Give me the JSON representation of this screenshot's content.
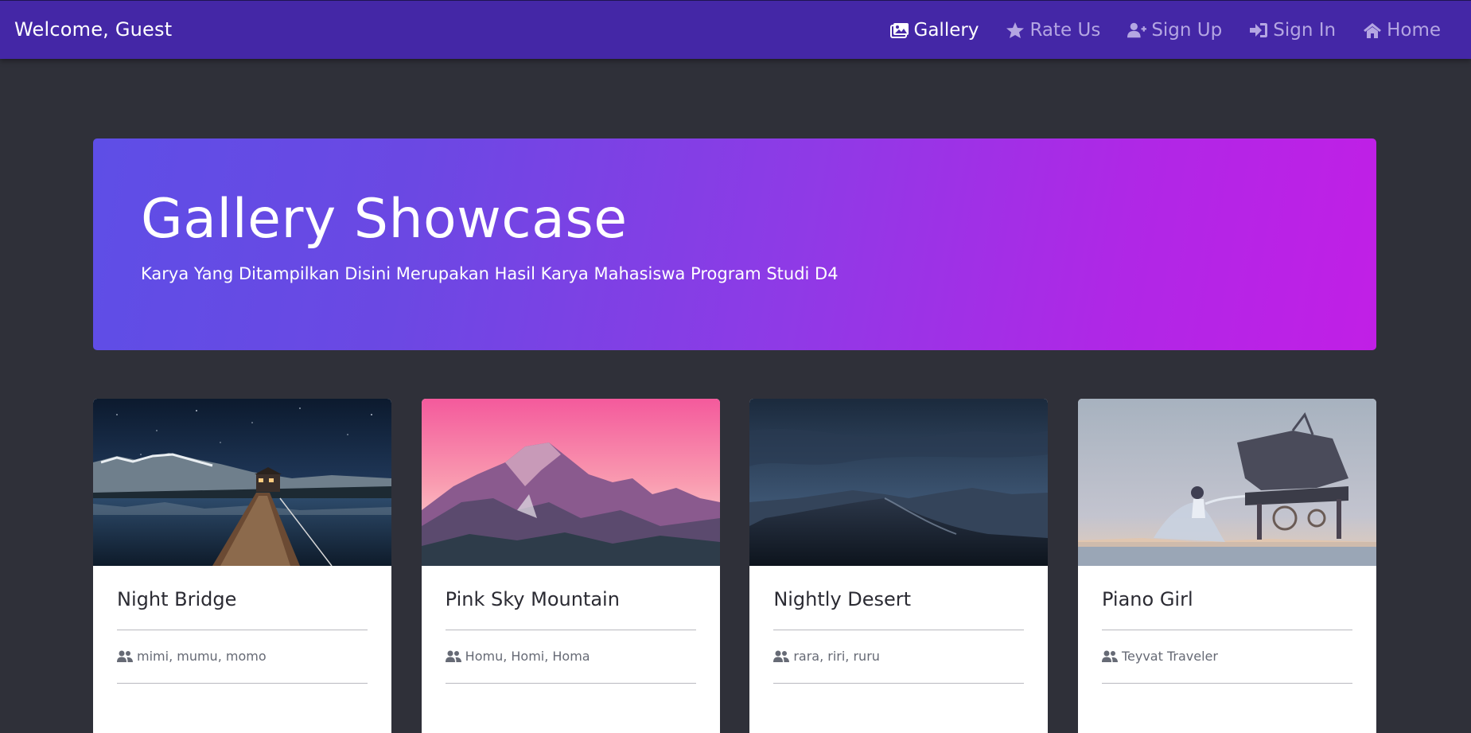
{
  "navbar": {
    "brand": "Welcome, Guest",
    "links": [
      {
        "label": "Gallery",
        "icon": "images-icon",
        "active": true
      },
      {
        "label": "Rate Us",
        "icon": "star-icon",
        "active": false
      },
      {
        "label": "Sign Up",
        "icon": "user-plus-icon",
        "active": false
      },
      {
        "label": "Sign In",
        "icon": "sign-in-icon",
        "active": false
      },
      {
        "label": "Home",
        "icon": "home-icon",
        "active": false
      }
    ]
  },
  "hero": {
    "title": "Gallery Showcase",
    "subtitle": "Karya Yang Ditampilkan Disini Merupakan Hasil Karya Mahasiswa Program Studi D4"
  },
  "cards": [
    {
      "title": "Night Bridge",
      "authors": "mimi, mumu, momo"
    },
    {
      "title": "Pink Sky Mountain",
      "authors": "Homu, Homi, Homa"
    },
    {
      "title": "Nightly Desert",
      "authors": "rara, riri, ruru"
    },
    {
      "title": "Piano Girl",
      "authors": "Teyvat Traveler"
    }
  ],
  "colors": {
    "navbar": "#4427a6",
    "background": "#2f3039",
    "hero_gradient_start": "#5e4ee6",
    "hero_gradient_end": "#c11fe6"
  }
}
